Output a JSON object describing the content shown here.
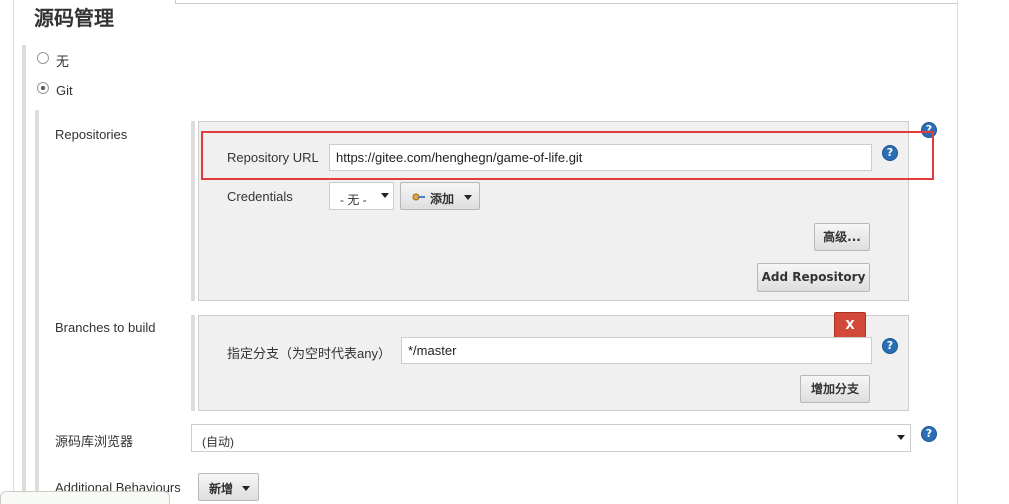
{
  "section": {
    "title": "源码管理"
  },
  "scm_options": {
    "none_label": "无",
    "git_label": "Git",
    "selected": "Git"
  },
  "repositories": {
    "label": "Repositories",
    "url_label": "Repository URL",
    "url_value": "https://gitee.com/henghegn/game-of-life.git",
    "credentials_label": "Credentials",
    "credentials_value": "- 无 -",
    "add_label": "添加",
    "advanced_label": "高级...",
    "add_repository_label": "Add Repository"
  },
  "branches": {
    "label": "Branches to build",
    "remove_label": "X",
    "specifier_label": "指定分支（为空时代表any）",
    "specifier_value": "*/master",
    "add_branch_label": "增加分支"
  },
  "browser": {
    "label": "源码库浏览器",
    "value": "(自动)"
  },
  "behaviours": {
    "label": "Additional Behaviours",
    "add_label": "新增"
  },
  "help_glyph": "?",
  "colors": {
    "highlight": "#e33b3b",
    "help_icon": "#2a6fb5",
    "delete_button": "#d24939"
  },
  "icons": [
    "help-icon",
    "key-icon",
    "dropdown-caret-icon"
  ]
}
